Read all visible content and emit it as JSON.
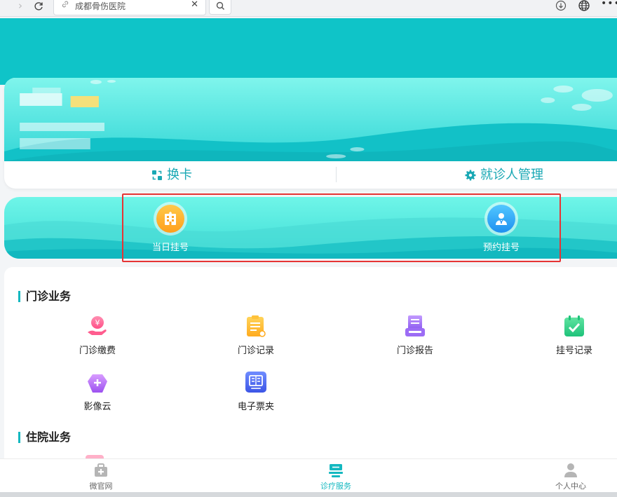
{
  "browser": {
    "tab_title": "成都骨伤医院"
  },
  "card": {
    "change_card": "换卡",
    "patient_manage": "就诊人管理"
  },
  "quick": {
    "today": "当日挂号",
    "appointment": "预约挂号"
  },
  "outpatient": {
    "title": "门诊业务",
    "items": [
      "门诊缴费",
      "门诊记录",
      "门诊报告",
      "挂号记录",
      "影像云",
      "电子票夹"
    ]
  },
  "inpatient": {
    "title": "住院业务"
  },
  "bottom_nav": {
    "items": [
      "微官网",
      "诊疗服务",
      "个人中心"
    ]
  },
  "colors": {
    "brand": "#14b8c0",
    "hero": "#0fc4c8",
    "highlight_box": "#e63434"
  }
}
